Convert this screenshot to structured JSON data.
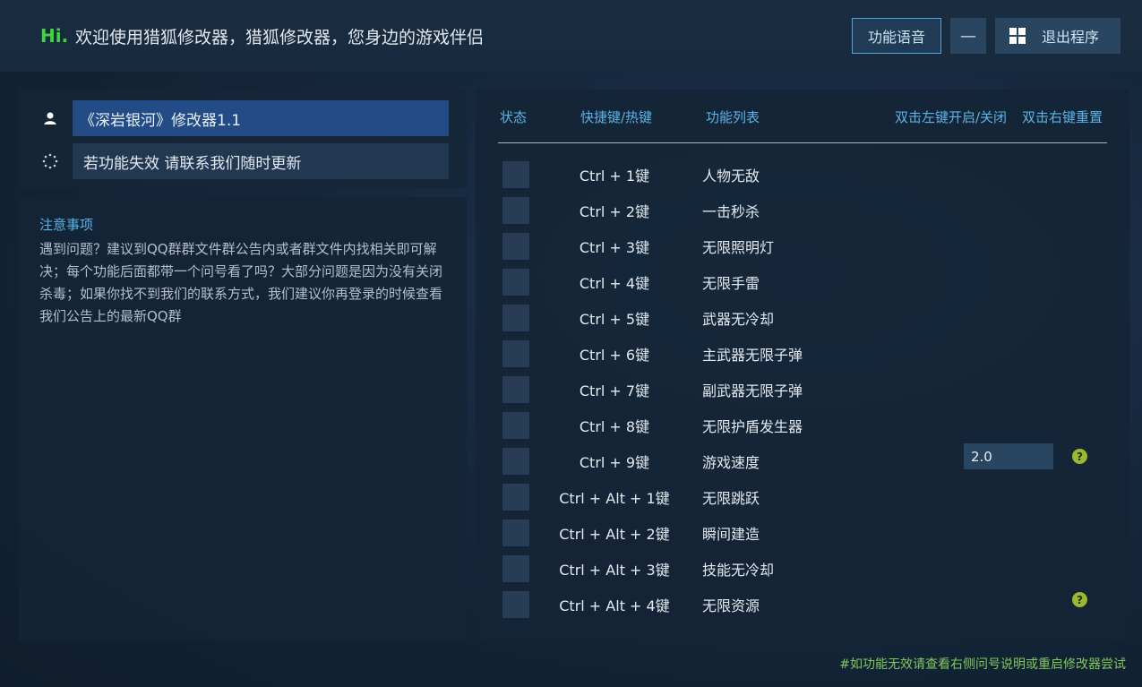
{
  "header": {
    "hi": "Hi.",
    "welcome": "欢迎使用猎狐修改器，猎狐修改器，您身边的游戏伴侣",
    "voice_button": "功能语音",
    "minimize_button": "—",
    "exit_button": "退出程序"
  },
  "game_panel": {
    "title": "《深岩银河》修改器1.1",
    "update_notice": "若功能失效  请联系我们随时更新"
  },
  "notice": {
    "title": "注意事项",
    "body": "遇到问题？建议到QQ群群文件群公告内或者群文件内找相关即可解决；每个功能后面都带一个问号看了吗？大部分问题是因为没有关闭杀毒；如果你找不到我们的联系方式，我们建议你再登录的时候查看我们公告上的最新QQ群"
  },
  "table": {
    "headers": {
      "status": "状态",
      "hotkey": "快捷键/热键",
      "function": "功能列表",
      "left_click": "双击左键开启/关闭",
      "right_click": "双击右键重置"
    },
    "rows": [
      {
        "hotkey": "Ctrl + 1键",
        "name": "人物无敌"
      },
      {
        "hotkey": "Ctrl + 2键",
        "name": "一击秒杀"
      },
      {
        "hotkey": "Ctrl + 3键",
        "name": "无限照明灯"
      },
      {
        "hotkey": "Ctrl + 4键",
        "name": "无限手雷"
      },
      {
        "hotkey": "Ctrl + 5键",
        "name": "武器无冷却"
      },
      {
        "hotkey": "Ctrl + 6键",
        "name": "主武器无限子弹"
      },
      {
        "hotkey": "Ctrl + 7键",
        "name": "副武器无限子弹"
      },
      {
        "hotkey": "Ctrl + 8键",
        "name": "无限护盾发生器"
      },
      {
        "hotkey": "Ctrl + 9键",
        "name": "游戏速度",
        "value": "2.0",
        "help": "?"
      },
      {
        "hotkey": "Ctrl + Alt + 1键",
        "name": "无限跳跃"
      },
      {
        "hotkey": "Ctrl + Alt + 2键",
        "name": "瞬间建造"
      },
      {
        "hotkey": "Ctrl + Alt + 3键",
        "name": "技能无冷却"
      },
      {
        "hotkey": "Ctrl + Alt + 4键",
        "name": "无限资源",
        "help": "?"
      }
    ]
  },
  "footer": "#如功能无效请查看右侧问号说明或重启修改器尝试",
  "colors": {
    "accent_green": "#3cd83c",
    "header_blue": "#5ab4e6",
    "selected_row": "#234b86",
    "help_badge": "#9cb92c"
  },
  "icons": {
    "user": "user-icon",
    "loading": "loading-icon",
    "windows": "windows-icon",
    "help": "help-icon"
  }
}
